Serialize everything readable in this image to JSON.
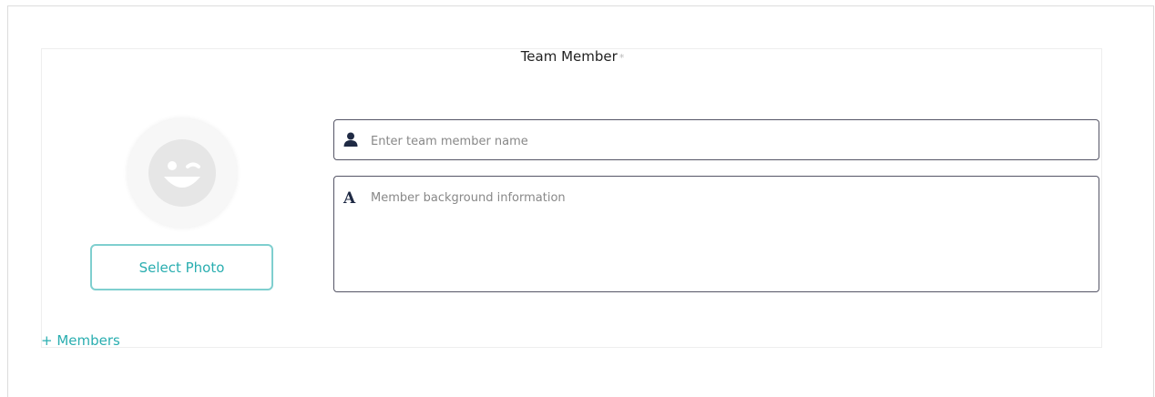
{
  "form": {
    "title": "Team Member",
    "required_mark": "*",
    "select_photo_label": "Select Photo",
    "name_placeholder": "Enter team member name",
    "name_value": "",
    "bio_placeholder": "Member background information",
    "bio_value": "",
    "bio_icon_glyph": "A",
    "add_members_label": "+ Members"
  },
  "icons": {
    "avatar": "winking-face-icon",
    "name": "user-icon",
    "bio": "text-icon"
  },
  "colors": {
    "accent": "#2aaeb0",
    "accent_border": "#7fcfcf",
    "field_border": "#555566",
    "icon_dark": "#1f2a44",
    "avatar_placeholder": "#e6e6e6"
  }
}
